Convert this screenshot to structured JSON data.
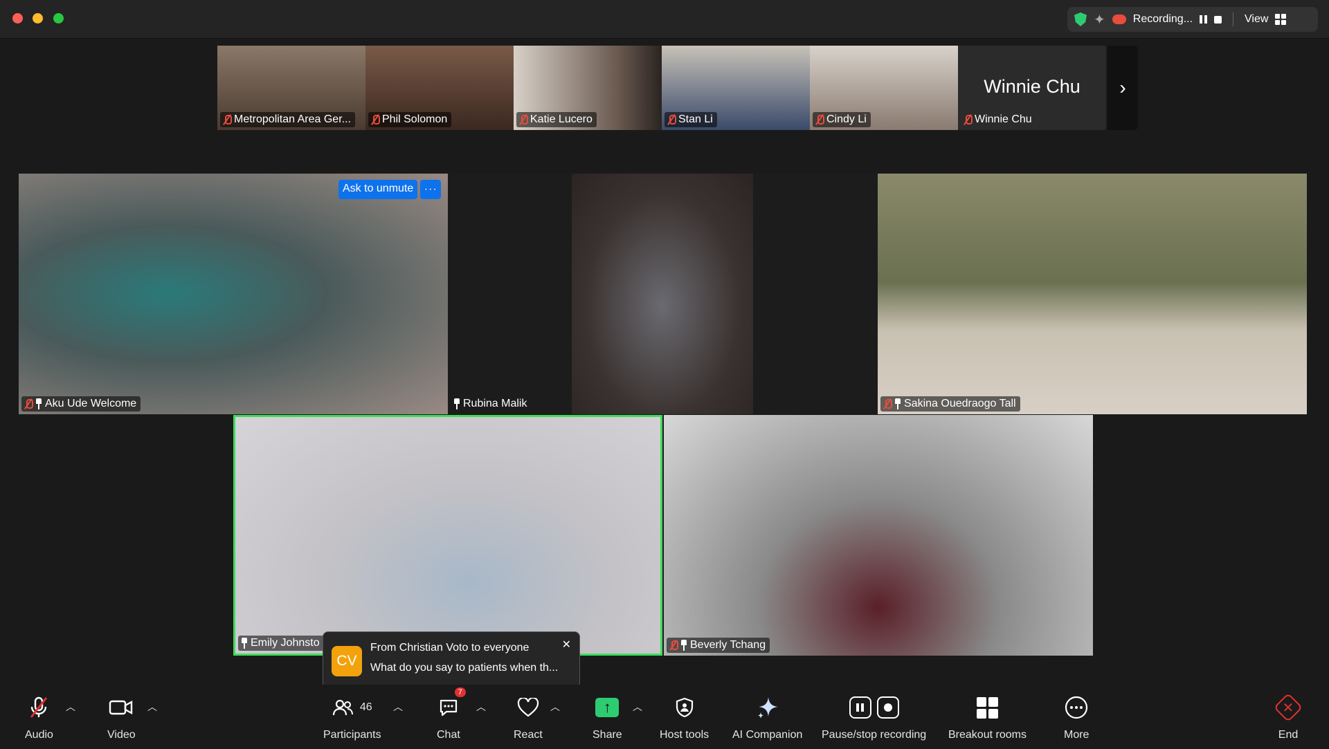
{
  "titlebar": {
    "recording_label": "Recording...",
    "view_label": "View"
  },
  "strip": {
    "participants": [
      {
        "name": "Metropolitan Area Ger...",
        "bg": "#6b5848"
      },
      {
        "name": "Phil Solomon",
        "bg": "#5a4237"
      },
      {
        "name": "Katie Lucero",
        "bg": "#9a8a7e"
      },
      {
        "name": "Stan Li",
        "bg": "#7a7468"
      },
      {
        "name": "Cindy Li",
        "bg": "#b8b0a6"
      }
    ],
    "avatar_tile": {
      "big_name": "Winnie Chu",
      "name": "Winnie Chu"
    },
    "next_icon": "chevron-right-icon"
  },
  "main": {
    "tiles": [
      {
        "name": "Aku Ude Welcome",
        "muted": true,
        "pinned": true,
        "bg": "#4a6464"
      },
      {
        "name": "Rubina Malik",
        "muted": false,
        "pinned": true,
        "bg": "#6f6660"
      },
      {
        "name": "Sakina Ouedraogo Tall",
        "muted": true,
        "pinned": true,
        "bg": "#b6ab98"
      },
      {
        "name": "Emily Johnsto",
        "muted": false,
        "pinned": true,
        "bg": "#c9c7cc",
        "active": true
      },
      {
        "name": "Beverly Tchang",
        "muted": true,
        "pinned": true,
        "bg": "#cfcfcf"
      }
    ],
    "ask_unmute_label": "Ask to unmute",
    "more_label": "···"
  },
  "toast": {
    "avatar_initials": "CV",
    "title": "From Christian Voto to everyone",
    "message": "What do you say to patients when th...",
    "close_label": "✕"
  },
  "toolbar": {
    "audio": "Audio",
    "video": "Video",
    "participants": "Participants",
    "participants_count": "46",
    "chat": "Chat",
    "chat_badge": "7",
    "react": "React",
    "share": "Share",
    "host_tools": "Host tools",
    "ai_companion": "AI Companion",
    "pause_stop": "Pause/stop recording",
    "breakout": "Breakout rooms",
    "more": "More",
    "end": "End",
    "accent_green": "#2ecc71",
    "end_red": "#e03131"
  }
}
